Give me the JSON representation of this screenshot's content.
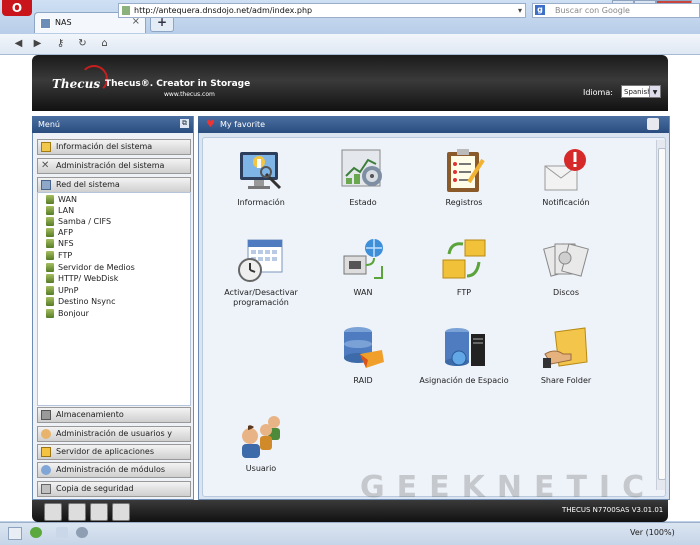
{
  "browser": {
    "tab_title": "NAS",
    "address": "http://antequera.dnsdojo.net/adm/index.php",
    "search_placeholder": "Buscar con Google",
    "zoom": "Ver (100%)"
  },
  "header": {
    "brand": "Thecus",
    "tagline": "Thecus®. Creator in Storage",
    "website": "www.thecus.com",
    "language_label": "Idioma:",
    "language_value": "Spanish"
  },
  "menu": {
    "title": "Menú",
    "categories_top": [
      {
        "label": "Información del sistema",
        "icon": "info-icon"
      },
      {
        "label": "Administración del sistema",
        "icon": "tools-icon"
      },
      {
        "label": "Red del sistema",
        "icon": "network-icon"
      }
    ],
    "subitems": [
      "WAN",
      "LAN",
      "Samba / CIFS",
      "AFP",
      "NFS",
      "FTP",
      "Servidor de Medios",
      "HTTP/ WebDisk",
      "UPnP",
      "Destino Nsync",
      "Bonjour"
    ],
    "categories_bottom": [
      {
        "label": "Almacenamiento",
        "icon": "storage-icon"
      },
      {
        "label": "Administración de usuarios y grupos",
        "icon": "users-icon"
      },
      {
        "label": "Servidor de aplicaciones",
        "icon": "apps-icon"
      },
      {
        "label": "Administración de módulos",
        "icon": "modules-icon"
      },
      {
        "label": "Copia de seguridad",
        "icon": "backup-icon"
      }
    ]
  },
  "main": {
    "title": "My favorite",
    "apps": [
      {
        "label": "Información",
        "icon": "monitor-info-icon"
      },
      {
        "label": "Estado",
        "icon": "status-chart-icon"
      },
      {
        "label": "Registros",
        "icon": "clipboard-icon"
      },
      {
        "label": "Notificación",
        "icon": "alert-mail-icon"
      },
      {
        "label": "Activar/Desactivar programación",
        "icon": "calendar-clock-icon"
      },
      {
        "label": "WAN",
        "icon": "network-globe-icon"
      },
      {
        "label": "FTP",
        "icon": "ftp-folder-icon"
      },
      {
        "label": "Discos",
        "icon": "disks-icon"
      },
      {
        "label": "RAID",
        "icon": "raid-icon"
      },
      {
        "label": "Asignación de Espacio",
        "icon": "server-space-icon"
      },
      {
        "label": "Share Folder",
        "icon": "share-folder-icon"
      },
      {
        "label": "Usuario",
        "icon": "users-group-icon"
      }
    ]
  },
  "footer": {
    "version": "THECUS N7700SAS V3.01.01"
  }
}
